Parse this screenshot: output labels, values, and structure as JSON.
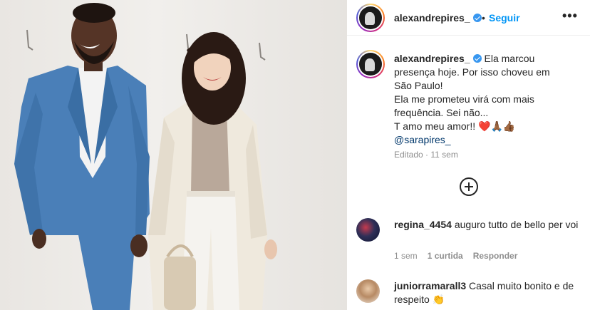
{
  "header": {
    "username": "alexandrepires_",
    "separator": "•",
    "follow_label": "Seguir",
    "more_label": "•••"
  },
  "caption": {
    "username": "alexandrepires_",
    "lines": [
      "Ela marcou",
      "presença hoje. Por isso choveu em",
      "São Paulo!",
      "Ela me prometeu virá com mais",
      "frequência. Sei não...",
      "T amo meu amor!!"
    ],
    "emojis": "❤️🙏🏾👍🏾",
    "mention": "@sarapires_",
    "meta": "Editado · 11 sem"
  },
  "load_more_icon": "plus-circle-icon",
  "comments": [
    {
      "username": "regina_4454",
      "text": "auguro tutto de bello per voi",
      "time": "1 sem",
      "likes": "1 curtida",
      "reply": "Responder"
    },
    {
      "username": "juniorramarall3",
      "text": "Casal muito bonito e de respeito 👏",
      "time": "",
      "likes": "",
      "reply": ""
    }
  ],
  "colors": {
    "accent": "#0095f6",
    "verified": "#3897f0",
    "text": "#262626",
    "muted": "#8e8e8e",
    "mention": "#00376b"
  }
}
